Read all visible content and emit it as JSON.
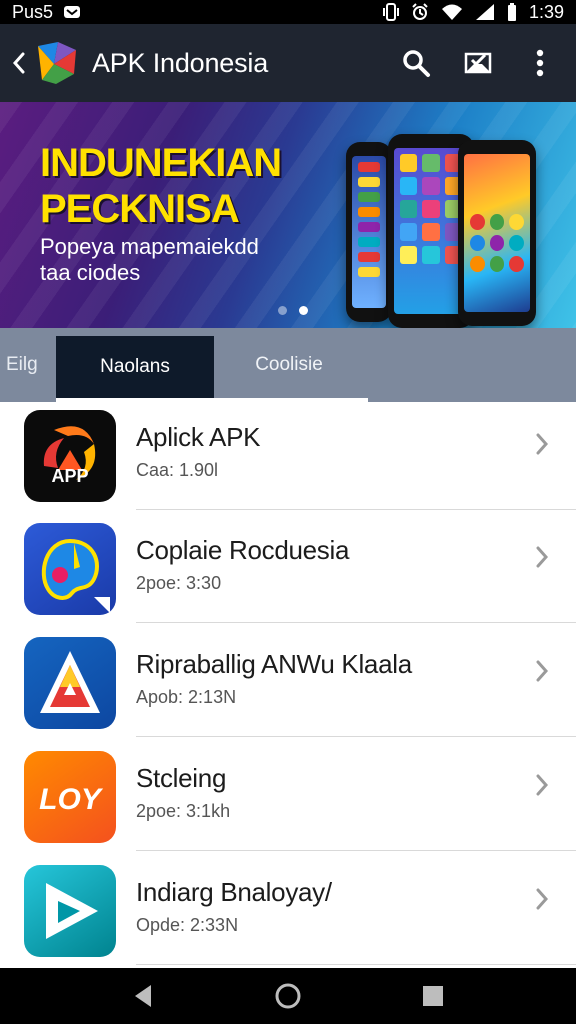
{
  "status_bar": {
    "carrier": "Pus5",
    "time": "1:39"
  },
  "app_bar": {
    "title": "APK Indonesia"
  },
  "banner": {
    "headline_line1": "INDUNEKIAN",
    "headline_line2": "PECKNISA",
    "desc_line1": "Popeya mapemaiekdd",
    "desc_line2": "taa ciodes",
    "slide_count": 2,
    "active_slide": 2
  },
  "tabs": {
    "partial": "Eilg",
    "selected": "Naolans",
    "third": "Coolisie"
  },
  "apps": [
    {
      "name": "Aplick APK",
      "meta": "Caa: 1.90l",
      "icon": "app-orange-swirl-icon",
      "icon_text": "APP"
    },
    {
      "name": "Coplaie Rocduesia",
      "meta": "2poe: 3:30",
      "icon": "palette-icon",
      "icon_text": ""
    },
    {
      "name": "Ripraballig ANWu Klaala",
      "meta": "Apob: 2:13N",
      "icon": "triangle-a-icon",
      "icon_text": ""
    },
    {
      "name": "Stcleing",
      "meta": "2poe: 3:1kh",
      "icon": "loy-logo-icon",
      "icon_text": "LOY"
    },
    {
      "name": "Indiarg Bnaloyay/",
      "meta": "Opde: 2:33N",
      "icon": "play-arrow-icon",
      "icon_text": ""
    }
  ],
  "colors": {
    "app_bar": "#1f2530",
    "tab_bar": "#7d899d",
    "tab_selected": "#0e1a2a",
    "banner_headline": "#ffe100"
  }
}
